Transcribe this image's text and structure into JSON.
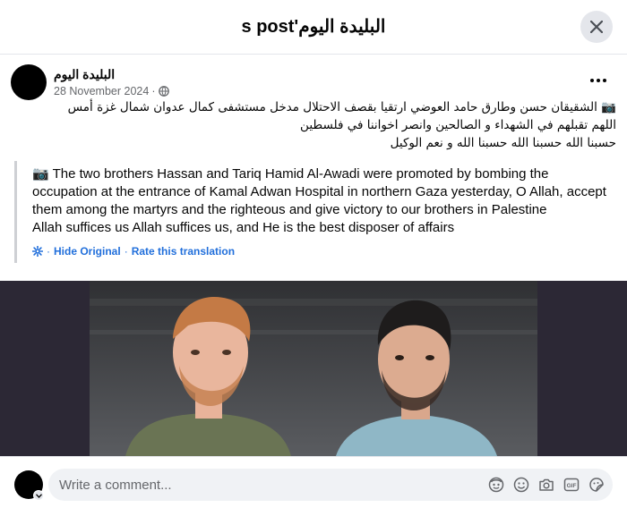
{
  "header": {
    "title": "s post'البليدة اليوم"
  },
  "post": {
    "author": "البليدة اليوم",
    "date": "28 November 2024",
    "date_separator": "·",
    "arabic_lines": [
      "📷 الشقيقان حسن وطارق حامد العوضي ارتقيا بقصف الاحتلال مدخل مستشفى كمال عدوان شمال غزة أمس",
      "اللهم تقبلهم في الشهداء و الصالحين وانصر اخواننا في فلسطين",
      "حسبنا الله حسبنا الله حسبنا الله و نعم الوكيل"
    ],
    "translation_lines": [
      "📷 The two brothers Hassan and Tariq Hamid Al-Awadi were promoted by bombing the",
      "occupation at the entrance of Kamal Adwan Hospital in northern Gaza yesterday, O Allah, accept",
      "them among the martyrs and the righteous and give victory to our brothers in Palestine",
      "Allah suffices us Allah suffices us, and He is the best disposer of affairs"
    ],
    "hide_original": "Hide Original",
    "link_separator": "·",
    "rate_translation": "Rate this translation"
  },
  "comment": {
    "placeholder": "Write a comment..."
  },
  "icons": {
    "close": "close-icon",
    "globe": "globe-icon",
    "more": "more-options-icon",
    "settings": "gear-icon",
    "avatar_emoji": "avatar-sticker-icon",
    "emoji": "smiley-icon",
    "camera": "camera-icon",
    "gif": "gif-icon",
    "sticker": "sticker-icon"
  },
  "colors": {
    "link": "#216fdb",
    "secondary_text": "#65676b",
    "comment_bg": "#f0f2f5"
  }
}
